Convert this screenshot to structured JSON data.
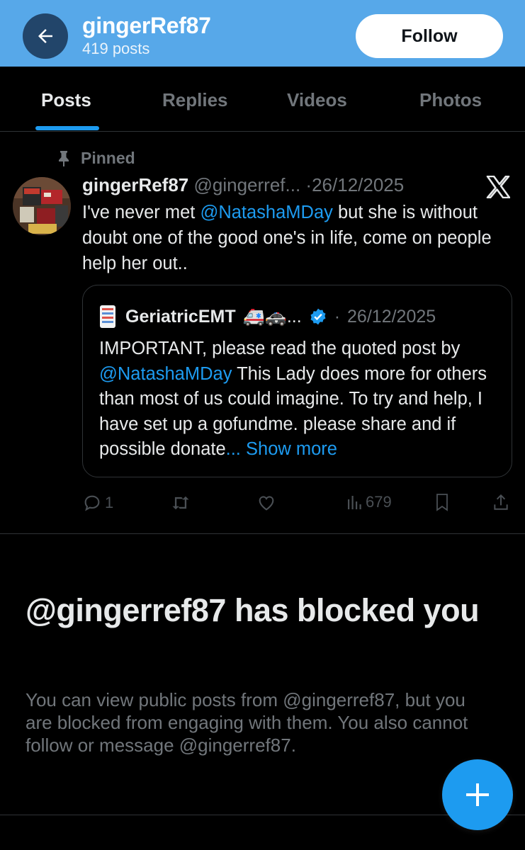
{
  "header": {
    "display_name": "gingerRef87",
    "post_count": "419 posts",
    "follow_label": "Follow"
  },
  "tabs": [
    {
      "label": "Posts",
      "active": true
    },
    {
      "label": "Replies",
      "active": false
    },
    {
      "label": "Videos",
      "active": false
    },
    {
      "label": "Photos",
      "active": false
    }
  ],
  "pinned_post": {
    "pinned_label": "Pinned",
    "author_name": "gingerRef87",
    "author_handle": "@gingerref...",
    "date": "26/12/2025",
    "text_before_mention": "I've never met ",
    "mention": "@NatashaMDay",
    "text_after_mention": " but she is without doubt one of the good one's in life, come on people help her out..",
    "quote": {
      "author_name": "GeriatricEMT",
      "author_emoji": "🚑🚓...",
      "date": "26/12/2025",
      "text_before_mention": "IMPORTANT, please read the quoted post by ",
      "mention": "@NatashaMDay",
      "text_after_mention": " This Lady does more for others than most of us could imagine. To try and help, I have set up a gofundme. please share and if possible donate",
      "ellipsis": "...",
      "show_more": "Show more"
    },
    "actions": {
      "reply_count": "1",
      "views_count": "679"
    }
  },
  "blocked": {
    "title": "@gingerref87 has blocked you",
    "description": "You can view public posts from @gingerref87, but you are blocked from engaging with them. You also cannot follow or message @gingerref87."
  },
  "colors": {
    "header_bg": "#57a8e9",
    "accent": "#1d9bf0",
    "muted": "#71767b"
  }
}
